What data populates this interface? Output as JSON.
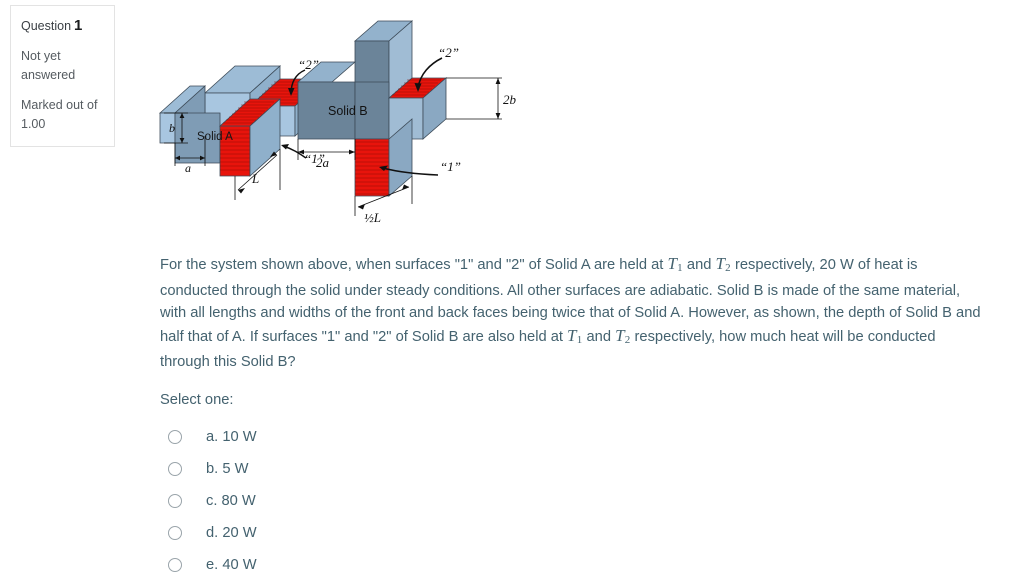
{
  "info_box": {
    "question_word": "Question",
    "question_number": "1",
    "status": "Not yet answered",
    "marks": "Marked out of 1.00"
  },
  "figure": {
    "solid_a": {
      "label": "Solid A",
      "dim_b": "b",
      "dim_a": "a",
      "dim_L": "L",
      "callout_top": "“2”",
      "callout_bottom": "“1”"
    },
    "solid_b": {
      "label": "Solid B",
      "dim_2b": "2b",
      "dim_2a": "2a",
      "dim_halfL": "½L",
      "callout_top": "“2”",
      "callout_bottom": "“1”"
    },
    "colors": {
      "face_light_blue": "#a8c6e0",
      "face_mid_blue": "#7f9cb5",
      "face_dark_blue": "#6b8499",
      "face_top_blue": "#8fb0cb",
      "hot_red": "#e8140c",
      "outline": "#3c4a57"
    }
  },
  "question": {
    "part1": "For the system shown above, when surfaces \"1\" and \"2\" of Solid A are held at ",
    "T1": "T",
    "T1_sub": "1",
    "part2": " and ",
    "T2": "T",
    "T2_sub": "2",
    "part3": " respectively, 20 W of heat is conducted through the solid under steady conditions. All other surfaces are adiabatic. Solid B is made of the same material, with all lengths and widths of the front and back faces being twice that of Solid A. However, as shown, the depth of Solid B and half that of A. If surfaces \"1\" and \"2\" of Solid B are also held at ",
    "T3": "T",
    "T3_sub": "1",
    "part4": " and ",
    "T4": "T",
    "T4_sub": "2",
    "part5": " respectively, how much heat will be conducted through this Solid B?"
  },
  "answers": {
    "prompt": "Select one:",
    "options": [
      {
        "id": "a",
        "label": "a. 10 W",
        "selected": false
      },
      {
        "id": "b",
        "label": "b. 5 W",
        "selected": false
      },
      {
        "id": "c",
        "label": "c. 80 W",
        "selected": false
      },
      {
        "id": "d",
        "label": "d. 20 W",
        "selected": false
      },
      {
        "id": "e",
        "label": "e. 40 W",
        "selected": false
      }
    ]
  }
}
